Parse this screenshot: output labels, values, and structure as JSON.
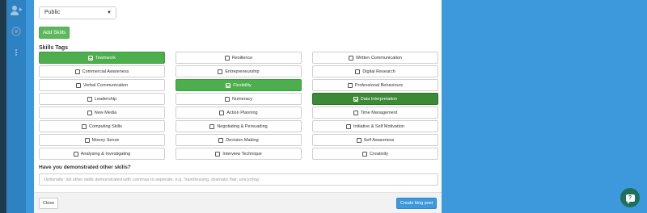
{
  "sidebar": {
    "icons": [
      "user-add-icon",
      "settings-icon",
      "more-icon"
    ]
  },
  "form": {
    "visibility_value": "Public",
    "add_skills_label": "Add Skills",
    "skills_tags_heading": "Skills Tags",
    "tags": [
      {
        "label": "Teamwork",
        "selected": true,
        "tone": "sel"
      },
      {
        "label": "Resilience",
        "selected": false,
        "tone": ""
      },
      {
        "label": "Written Communication",
        "selected": false,
        "tone": ""
      },
      {
        "label": "Commercial Awareness",
        "selected": false,
        "tone": ""
      },
      {
        "label": "Entrepreneurship",
        "selected": false,
        "tone": ""
      },
      {
        "label": "Digital Research",
        "selected": false,
        "tone": ""
      },
      {
        "label": "Verbal Communication",
        "selected": false,
        "tone": ""
      },
      {
        "label": "Flexibility",
        "selected": true,
        "tone": "sel"
      },
      {
        "label": "Professional Behaviours",
        "selected": false,
        "tone": ""
      },
      {
        "label": "Leadership",
        "selected": false,
        "tone": ""
      },
      {
        "label": "Numeracy",
        "selected": false,
        "tone": ""
      },
      {
        "label": "Data Interpretation",
        "selected": true,
        "tone": "sel-dark"
      },
      {
        "label": "New Media",
        "selected": false,
        "tone": ""
      },
      {
        "label": "Action Planning",
        "selected": false,
        "tone": ""
      },
      {
        "label": "Time Management",
        "selected": false,
        "tone": ""
      },
      {
        "label": "Computing Skills",
        "selected": false,
        "tone": ""
      },
      {
        "label": "Negotiating & Persuading",
        "selected": false,
        "tone": ""
      },
      {
        "label": "Initiative & Self Motivation",
        "selected": false,
        "tone": ""
      },
      {
        "label": "Money Sense",
        "selected": false,
        "tone": ""
      },
      {
        "label": "Decision Making",
        "selected": false,
        "tone": ""
      },
      {
        "label": "Self Awareness",
        "selected": false,
        "tone": ""
      },
      {
        "label": "Analysing & Investigating",
        "selected": false,
        "tone": ""
      },
      {
        "label": "Interview Technique",
        "selected": false,
        "tone": ""
      },
      {
        "label": "Creativity",
        "selected": false,
        "tone": ""
      }
    ],
    "other_skills_question": "Have you demonstrated other skills?",
    "other_skills_placeholder": "Optionally: list other skills demonstrated with commas to seperate. e.g. 'hairdressing, dramatic flair, unicycling.'",
    "other_skills_value": ""
  },
  "footer": {
    "close_label": "Close",
    "create_label": "Create blog post"
  },
  "chat": {
    "icon": "chat-icon",
    "glyph": "?"
  },
  "colors": {
    "page_bg": "#3d99dc",
    "selected_green": "#4cae4c",
    "selected_dark_green": "#3c8a36",
    "primary_blue": "#3d99dc"
  }
}
